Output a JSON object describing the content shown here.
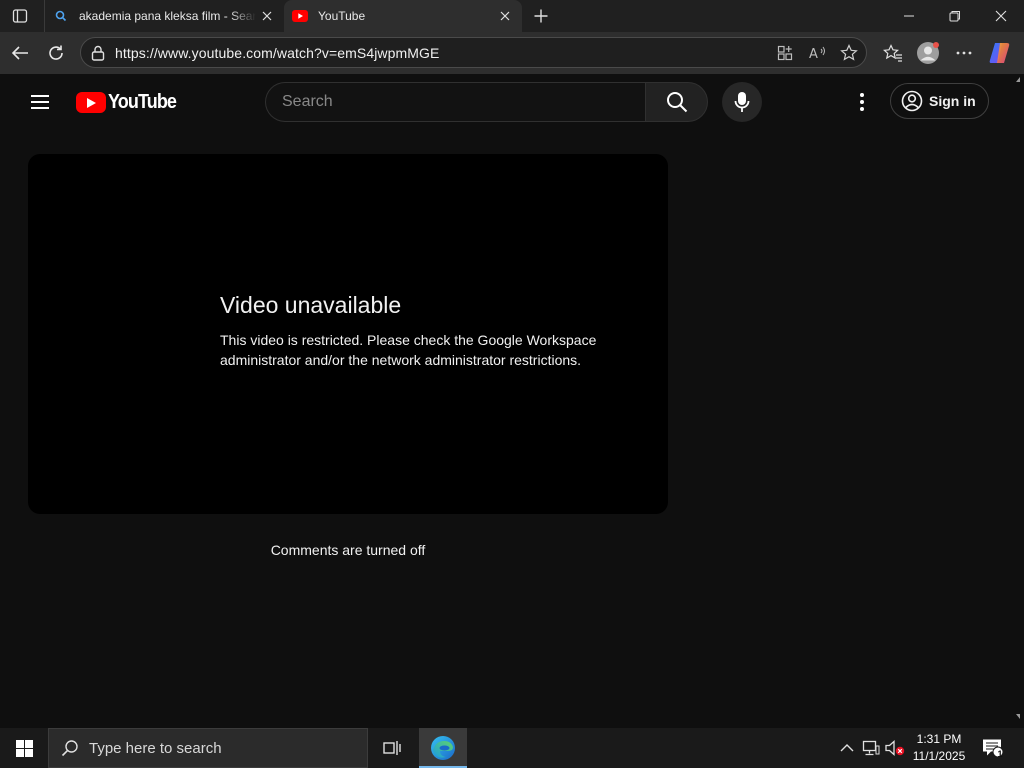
{
  "browser": {
    "tabs": [
      {
        "title": "akademia pana kleksa film - Search",
        "favicon": "search-icon",
        "active": false
      },
      {
        "title": "YouTube",
        "favicon": "youtube-icon",
        "active": true
      }
    ],
    "address_bar": {
      "url": "https://www.youtube.com/watch?v=emS4jwpmMGE"
    }
  },
  "youtube": {
    "logo_text": "YouTube",
    "search": {
      "placeholder": "Search",
      "value": ""
    },
    "sign_in_label": "Sign in",
    "player": {
      "title": "Video unavailable",
      "message": "This video is restricted. Please check the Google Workspace administrator and/or the network administrator restrictions."
    },
    "comments_status": "Comments are turned off"
  },
  "taskbar": {
    "search_placeholder": "Type here to search",
    "time": "1:31 PM",
    "date": "11/1/2025",
    "notification_count": "1"
  },
  "colors": {
    "yt_red": "#ff0000",
    "page_bg": "#0f0f0f",
    "player_bg": "#000000",
    "browser_chrome": "#2e2e2e",
    "taskbar_bg": "#1a1a1a"
  }
}
